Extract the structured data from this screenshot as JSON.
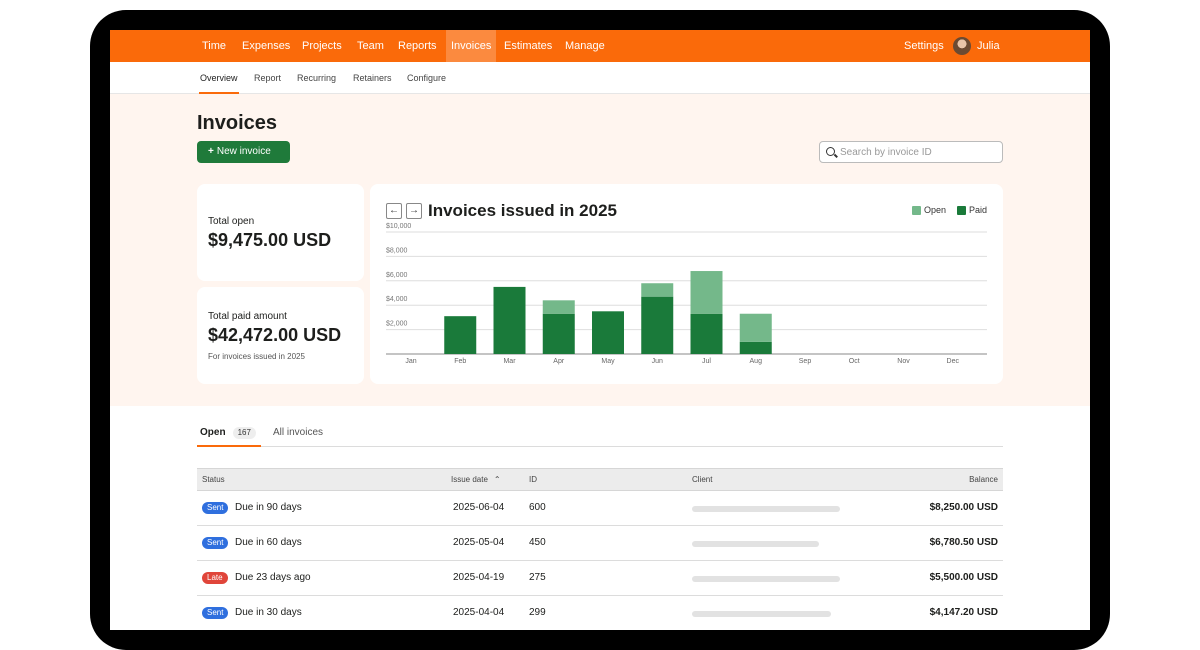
{
  "nav": {
    "items": [
      "Time",
      "Expenses",
      "Projects",
      "Team",
      "Reports",
      "Invoices",
      "Estimates",
      "Manage"
    ],
    "active": "Invoices",
    "settings": "Settings",
    "user": "Julia"
  },
  "subnav": {
    "items": [
      "Overview",
      "Report",
      "Recurring",
      "Retainers",
      "Configure"
    ],
    "active": "Overview"
  },
  "page": {
    "title": "Invoices",
    "new_button": "New invoice",
    "search_placeholder": "Search by invoice ID"
  },
  "summary": {
    "open_label": "Total open",
    "open_value": "$9,475.00 USD",
    "paid_label": "Total paid amount",
    "paid_value": "$42,472.00 USD",
    "paid_note": "For invoices issued in 2025"
  },
  "chart_data": {
    "type": "bar",
    "title": "Invoices issued in 2025",
    "stacked": true,
    "categories": [
      "Jan",
      "Feb",
      "Mar",
      "Apr",
      "May",
      "Jun",
      "Jul",
      "Aug",
      "Sep",
      "Oct",
      "Nov",
      "Dec"
    ],
    "series": [
      {
        "name": "Paid",
        "color": "#1a7a3a",
        "values": [
          0,
          3100,
          5500,
          3300,
          3500,
          4700,
          3300,
          1000,
          0,
          0,
          0,
          0
        ]
      },
      {
        "name": "Open",
        "color": "#74b88a",
        "values": [
          0,
          0,
          0,
          1100,
          0,
          1100,
          3500,
          2300,
          0,
          0,
          0,
          0
        ]
      }
    ],
    "yticks": [
      "$2,000",
      "$4,000",
      "$6,000",
      "$8,000",
      "$10,000"
    ],
    "ylim": [
      0,
      10000
    ],
    "legend": "top-right",
    "grid": true
  },
  "tabs": {
    "open_label": "Open",
    "open_count": "167",
    "all_label": "All invoices"
  },
  "table": {
    "headers": {
      "status": "Status",
      "issue_date": "Issue date",
      "id": "ID",
      "client": "Client",
      "balance": "Balance"
    },
    "rows": [
      {
        "badge": "Sent",
        "badge_color": "#2f6fde",
        "status": "Due in 90 days",
        "date": "2025-06-04",
        "id": "600",
        "balance": "$8,250.00 USD"
      },
      {
        "badge": "Sent",
        "badge_color": "#2f6fde",
        "status": "Due in 60 days",
        "date": "2025-05-04",
        "id": "450",
        "balance": "$6,780.50 USD"
      },
      {
        "badge": "Late",
        "badge_color": "#e0453a",
        "status": "Due 23 days ago",
        "date": "2025-04-19",
        "id": "275",
        "balance": "$5,500.00 USD"
      },
      {
        "badge": "Sent",
        "badge_color": "#2f6fde",
        "status": "Due in 30 days",
        "date": "2025-04-04",
        "id": "299",
        "balance": "$4,147.20 USD"
      }
    ]
  },
  "colors": {
    "brand": "#fa6a0a",
    "primary_button": "#1f7a3a"
  }
}
